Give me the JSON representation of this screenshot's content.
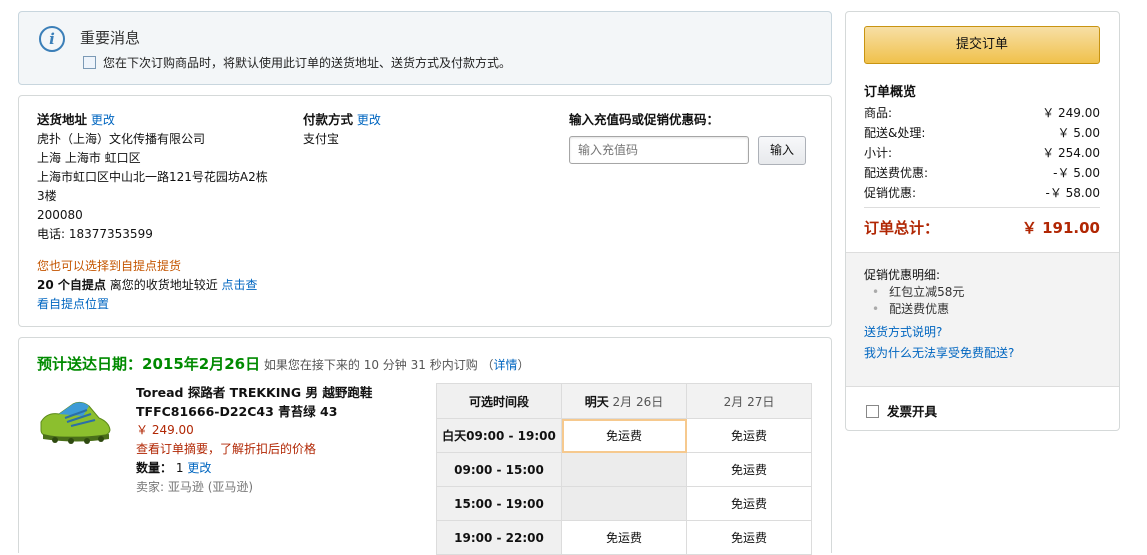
{
  "notice": {
    "icon": "info-icon",
    "title": "重要消息",
    "checkbox_label": "您在下次订购商品时，将默认使用此订单的送货地址、送货方式及付款方式。"
  },
  "address": {
    "heading": "送货地址",
    "change": "更改",
    "lines": [
      "虎扑（上海）文化传播有限公司",
      "上海 上海市 虹口区",
      "上海市虹口区中山北一路121号花园坊A2栋",
      "3楼",
      "200080",
      "电话: 18377353599"
    ]
  },
  "payment": {
    "heading": "付款方式",
    "change": "更改",
    "method": "支付宝"
  },
  "promo": {
    "heading": "输入充值码或促销优惠码：",
    "placeholder": "输入充值码",
    "button": "输入"
  },
  "pickup": {
    "line1": "您也可以选择到自提点提货",
    "count": "20 个自提点",
    "line2": " 离您的收货地址较近 ",
    "link": "点击查",
    "link2": "看自提点位置"
  },
  "delivery": {
    "label": "预计送达日期：",
    "date": "2015年2月26日",
    "hint": " 如果您在接下来的 10 分钟 31 秒内订购 （",
    "detail_link": "详情",
    "hint_end": "）"
  },
  "product": {
    "name_line1": "Toread 探路者 TREKKING 男 越野跑鞋",
    "name_line2": "TFFC81666-D22C43 青苔绿 43",
    "price": "￥ 249.00",
    "note": "查看订单摘要，了解折扣后的价格",
    "qty_label": "数量：",
    "qty": "1",
    "qty_change": "更改",
    "seller_label": "卖家:",
    "seller": "亚马逊 (亚马逊)"
  },
  "schedule": {
    "col_header": "可选时间段",
    "day1_bold": "明天",
    "day1": " 2月 26日",
    "day2": "2月 27日",
    "rows": [
      {
        "slot": "白天09:00 - 19:00",
        "d1": "免运费",
        "d2": "免运费"
      },
      {
        "slot": "09:00 - 15:00",
        "d1": "",
        "d2": "免运费"
      },
      {
        "slot": "15:00 - 19:00",
        "d1": "",
        "d2": "免运费"
      },
      {
        "slot": "19:00 - 22:00",
        "d1": "免运费",
        "d2": "免运费"
      }
    ]
  },
  "summary": {
    "submit": "提交订单",
    "title": "订单概览",
    "rows": [
      {
        "label": "商品:",
        "value": "￥ 249.00"
      },
      {
        "label": "配送&处理:",
        "value": "￥ 5.00"
      },
      {
        "label": "小计:",
        "value": "￥ 254.00"
      },
      {
        "label": "配送费优惠:",
        "value": "-￥ 5.00"
      },
      {
        "label": "促销优惠:",
        "value": "-￥ 58.00"
      }
    ],
    "total_label": "订单总计：",
    "total_value": "￥ 191.00",
    "promo_title": "促销优惠明细:",
    "promo_items": [
      "红包立减58元",
      "配送费优惠"
    ],
    "link1": "送货方式说明?",
    "link2": "我为什么无法享受免费配送?",
    "invoice": "发票开具"
  },
  "colors": {
    "accent": "#f0c14b",
    "link": "#0066c0",
    "price": "#b12704",
    "green": "#008a00"
  }
}
